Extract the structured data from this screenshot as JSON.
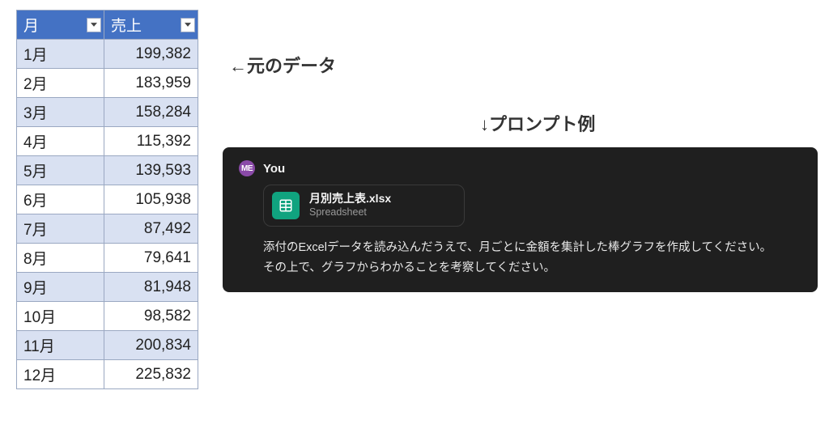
{
  "labels": {
    "original_data": "←元のデータ",
    "prompt_example": "↓プロンプト例"
  },
  "table": {
    "headers": {
      "month": "月",
      "sales": "売上"
    },
    "rows": [
      {
        "month": "1月",
        "value": "199,382"
      },
      {
        "month": "2月",
        "value": "183,959"
      },
      {
        "month": "3月",
        "value": "158,284"
      },
      {
        "month": "4月",
        "value": "115,392"
      },
      {
        "month": "5月",
        "value": "139,593"
      },
      {
        "month": "6月",
        "value": "105,938"
      },
      {
        "month": "7月",
        "value": "87,492"
      },
      {
        "month": "8月",
        "value": "79,641"
      },
      {
        "month": "9月",
        "value": "81,948"
      },
      {
        "month": "10月",
        "value": "98,582"
      },
      {
        "month": "11月",
        "value": "200,834"
      },
      {
        "month": "12月",
        "value": "225,832"
      }
    ]
  },
  "chat": {
    "avatar_initials": "ME",
    "sender": "You",
    "attachment": {
      "filename": "月別売上表.xlsx",
      "filetype": "Spreadsheet"
    },
    "message_line1": "添付のExcelデータを読み込んだうえで、月ごとに金額を集計した棒グラフを作成してください。",
    "message_line2": "その上で、グラフからわかることを考察してください。"
  },
  "chart_data": {
    "type": "bar",
    "title": "月別売上表",
    "xlabel": "月",
    "ylabel": "売上",
    "categories": [
      "1月",
      "2月",
      "3月",
      "4月",
      "5月",
      "6月",
      "7月",
      "8月",
      "9月",
      "10月",
      "11月",
      "12月"
    ],
    "values": [
      199382,
      183959,
      158284,
      115392,
      139593,
      105938,
      87492,
      79641,
      81948,
      98582,
      200834,
      225832
    ]
  }
}
